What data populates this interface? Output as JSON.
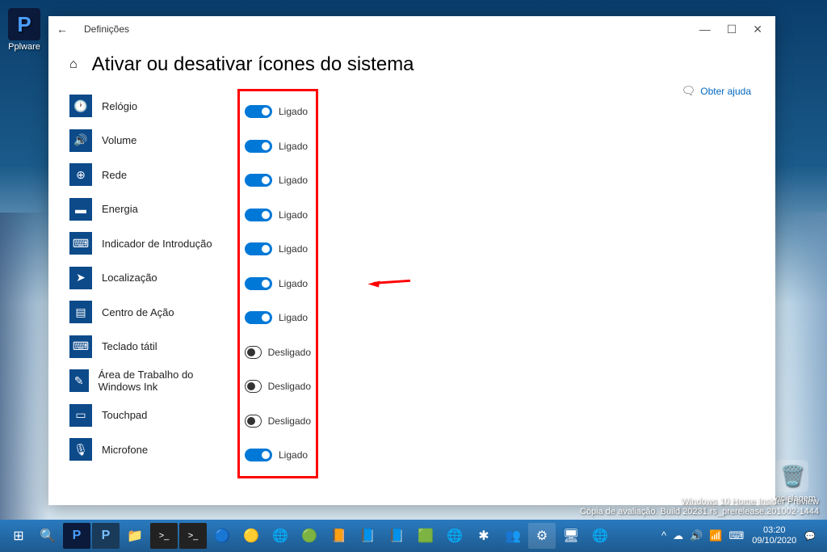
{
  "desktop": {
    "pplware_label": "Pplware",
    "recycle_label": "Reciclagem"
  },
  "window": {
    "title": "Definições",
    "page_title": "Ativar ou desativar ícones do sistema",
    "help_label": "Obter ajuda"
  },
  "items": [
    {
      "label": "Relógio",
      "icon": "clock",
      "glyph": "🕐",
      "on": true,
      "state": "Ligado"
    },
    {
      "label": "Volume",
      "icon": "volume",
      "glyph": "🔊",
      "on": true,
      "state": "Ligado"
    },
    {
      "label": "Rede",
      "icon": "network",
      "glyph": "⊕",
      "on": true,
      "state": "Ligado"
    },
    {
      "label": "Energia",
      "icon": "power",
      "glyph": "▬",
      "on": true,
      "state": "Ligado"
    },
    {
      "label": "Indicador de Introdução",
      "icon": "input",
      "glyph": "⌨",
      "on": true,
      "state": "Ligado"
    },
    {
      "label": "Localização",
      "icon": "location",
      "glyph": "➤",
      "on": true,
      "state": "Ligado"
    },
    {
      "label": "Centro de Ação",
      "icon": "action-center",
      "glyph": "▤",
      "on": true,
      "state": "Ligado"
    },
    {
      "label": "Teclado tátil",
      "icon": "touch-keyboard",
      "glyph": "⌨",
      "on": false,
      "state": "Desligado"
    },
    {
      "label": "Área de Trabalho do Windows Ink",
      "icon": "ink",
      "glyph": "✎",
      "on": false,
      "state": "Desligado"
    },
    {
      "label": "Touchpad",
      "icon": "touchpad",
      "glyph": "▭",
      "on": false,
      "state": "Desligado"
    },
    {
      "label": "Microfone",
      "icon": "microphone",
      "glyph": "🎙",
      "on": true,
      "state": "Ligado"
    }
  ],
  "watermark": {
    "line1": "Windows 10 Home Insider Preview",
    "line2": "Cópia de avaliação. Build 20231.rs_prerelease.201002-1444"
  },
  "taskbar": {
    "time": "03:20",
    "date": "09/10/2020"
  }
}
